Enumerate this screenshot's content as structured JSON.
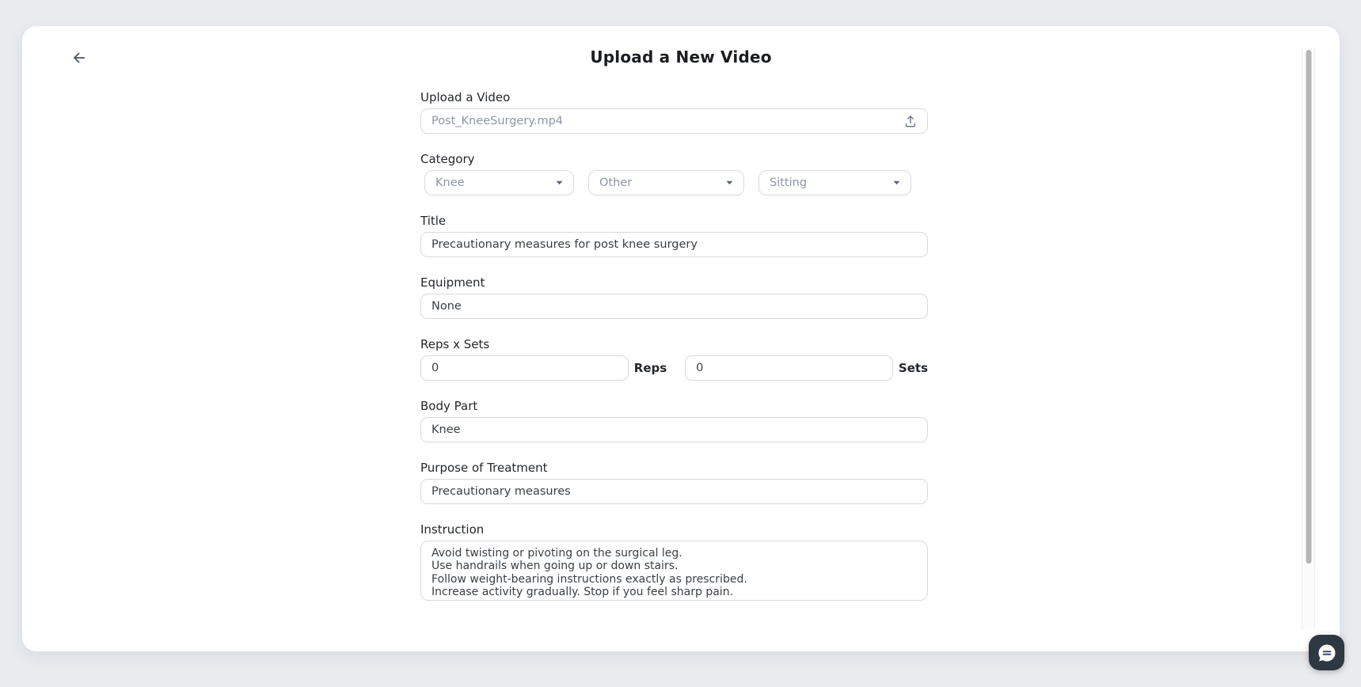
{
  "page": {
    "title": "Upload a New Video"
  },
  "form": {
    "upload": {
      "label": "Upload a Video",
      "filename": "Post_KneeSurgery.mp4"
    },
    "category": {
      "label": "Category",
      "dropdowns": [
        {
          "value": "Knee"
        },
        {
          "value": "Other"
        },
        {
          "value": "Sitting"
        }
      ]
    },
    "title_field": {
      "label": "Title",
      "value": "Precautionary measures for post knee surgery"
    },
    "equipment": {
      "label": "Equipment",
      "value": "None"
    },
    "reps_sets": {
      "label": "Reps x Sets",
      "reps_value": "0",
      "reps_suffix": "Reps",
      "sets_value": "0",
      "sets_suffix": "Sets"
    },
    "body_part": {
      "label": "Body Part",
      "value": "Knee"
    },
    "purpose": {
      "label": "Purpose of Treatment",
      "value": "Precautionary measures"
    },
    "instruction": {
      "label": "Instruction",
      "value": "Avoid twisting or pivoting on the surgical leg.\nUse handrails when going up or down stairs.\nFollow weight-bearing instructions exactly as prescribed.\nIncrease activity gradually. Stop if you feel sharp pain."
    }
  },
  "icons": {
    "back": "arrow-left",
    "upload": "upload-tray-arrow",
    "dropdown": "caret-down",
    "chat": "speech-bubble"
  },
  "colors": {
    "page_background": "#e9ebef",
    "card_background": "#ffffff",
    "input_border": "#d6dadf",
    "label_text": "#24272c",
    "value_text": "#3a3f46",
    "muted_text": "#8c96a5",
    "title_text": "#1b1d21",
    "scrollbar_thumb": "#b4b6b8",
    "chat_widget": "#2e3843",
    "chat_lines": "#3c4e6a"
  }
}
